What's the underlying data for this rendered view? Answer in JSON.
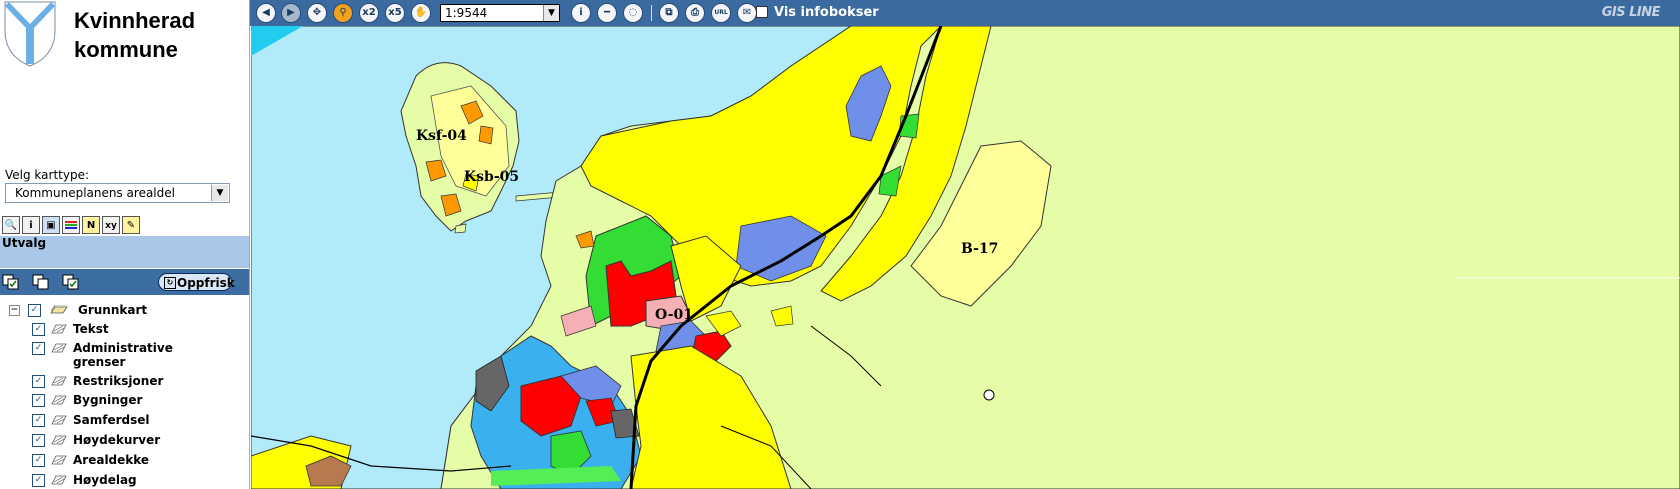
{
  "header": {
    "municipality_line1": "Kvinnherad",
    "municipality_line2": "kommune"
  },
  "maptype": {
    "label": "Velg karttype:",
    "selected": "Kommuneplanens arealdel"
  },
  "tools": {
    "icons": [
      "search-map-icon",
      "info-icon",
      "measure-icon",
      "legend-icon",
      "north-arrow-icon",
      "coordinate-icon",
      "edit-icon"
    ],
    "info_text": "i",
    "coord_text": "xy"
  },
  "utvalg": {
    "label": "Utvalg"
  },
  "layers_bar": {
    "refresh_label": "Oppfrisk"
  },
  "layer_group": {
    "name": "Grunnkart",
    "checked": true,
    "layers": [
      {
        "name": "Tekst",
        "checked": true
      },
      {
        "name": "Administrative grenser",
        "checked": true
      },
      {
        "name": "Restriksjoner",
        "checked": true
      },
      {
        "name": "Bygninger",
        "checked": true
      },
      {
        "name": "Samferdsel",
        "checked": true
      },
      {
        "name": "Høydekurver",
        "checked": true
      },
      {
        "name": "Arealdekke",
        "checked": true
      },
      {
        "name": "Høydelag",
        "checked": true
      }
    ]
  },
  "toolbar": {
    "zoom_x2": "x2",
    "zoom_x5": "x5",
    "scale_value": "1:9544",
    "info_text": "i",
    "url_text": "URL",
    "vis_infobokser_label": "Vis infobokser",
    "vis_infobokser_checked": false,
    "brand": "GIS LINE"
  },
  "map": {
    "zone_labels": [
      "Ksf-04",
      "Ksb-05",
      "B-17",
      "O-01"
    ],
    "colors": {
      "water": "#b1ebf9",
      "agriculture": "#e5fda6",
      "residential": "#ffff00",
      "pale_residential": "#ffff99",
      "public": "#f4b0b4",
      "commercial": "#ff0000",
      "park": "#33dd33",
      "industry": "#6f8fe9",
      "harbour": "#3ab0ee",
      "leisure": "#ff9900",
      "road": "#000000"
    }
  }
}
